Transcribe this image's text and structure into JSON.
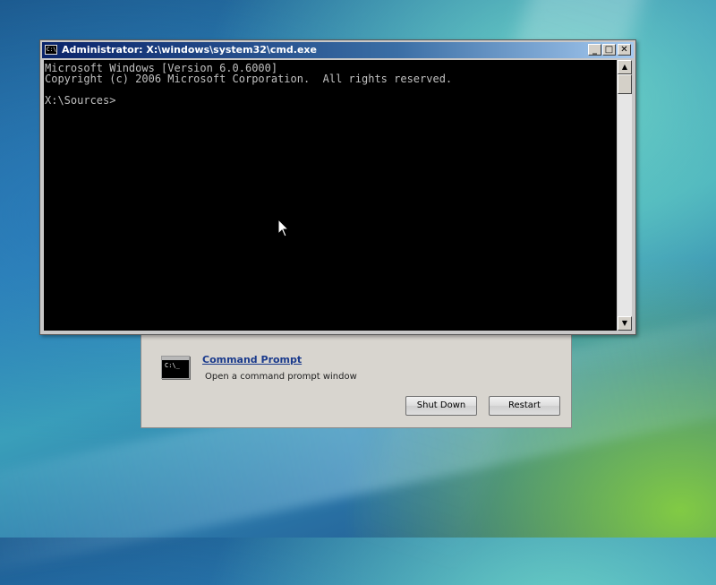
{
  "cmd_window": {
    "title": "Administrator: X:\\windows\\system32\\cmd.exe",
    "icon_text": "C:\\",
    "buttons": {
      "minimize": "_",
      "maximize": "□",
      "close": "✕"
    },
    "console_lines": [
      "Microsoft Windows [Version 6.0.6000]",
      "Copyright (c) 2006 Microsoft Corporation.  All rights reserved.",
      "",
      "X:\\Sources>"
    ],
    "scrollbar": {
      "up_arrow": "▲",
      "down_arrow": "▼"
    }
  },
  "recovery_panel": {
    "icon_text": "C:\\_",
    "option_title": "Command Prompt",
    "option_description": "Open a command prompt window",
    "shutdown_label": "Shut Down",
    "restart_label": "Restart"
  },
  "colors": {
    "title_bar": "#0a246a",
    "console_background": "#000000",
    "console_text": "#c0c0c0",
    "link": "#1a3a8c"
  }
}
